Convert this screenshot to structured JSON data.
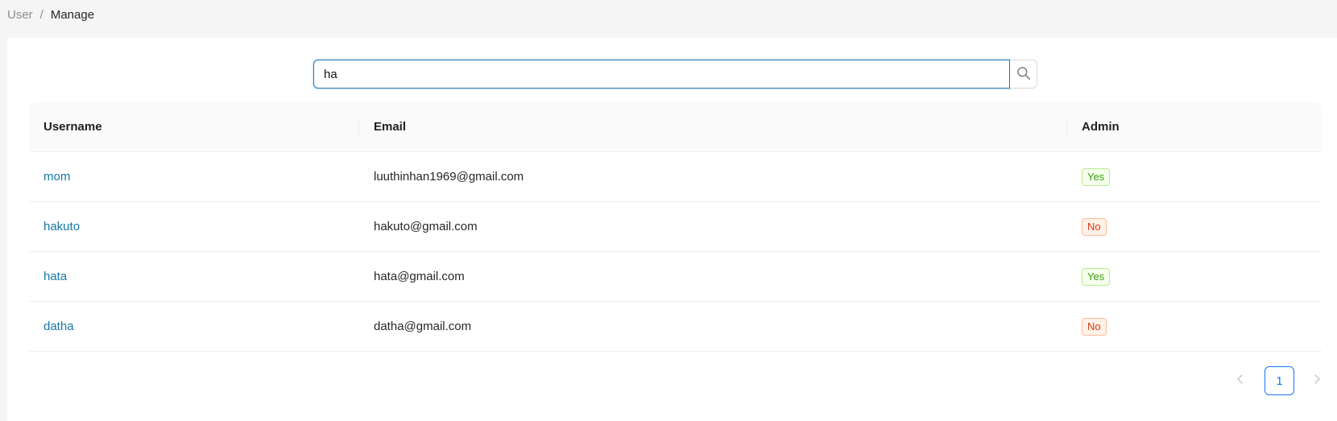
{
  "breadcrumb": {
    "root": "User",
    "separator": "/",
    "current": "Manage"
  },
  "search": {
    "value": "ha",
    "icon": "search-icon"
  },
  "table": {
    "columns": [
      "Username",
      "Email",
      "Admin"
    ],
    "rows": [
      {
        "username": "mom",
        "email": "luuthinhan1969@gmail.com",
        "admin": "Yes"
      },
      {
        "username": "hakuto",
        "email": "hakuto@gmail.com",
        "admin": "No"
      },
      {
        "username": "hata",
        "email": "hata@gmail.com",
        "admin": "Yes"
      },
      {
        "username": "datha",
        "email": "datha@gmail.com",
        "admin": "No"
      }
    ]
  },
  "pagination": {
    "current_page": "1",
    "prev_icon": "chevron-left-icon",
    "next_icon": "chevron-right-icon"
  },
  "colors": {
    "link": "#1677a6",
    "primary": "#1677ff",
    "yes_tag": "#389e0d",
    "no_tag": "#d4380d"
  }
}
